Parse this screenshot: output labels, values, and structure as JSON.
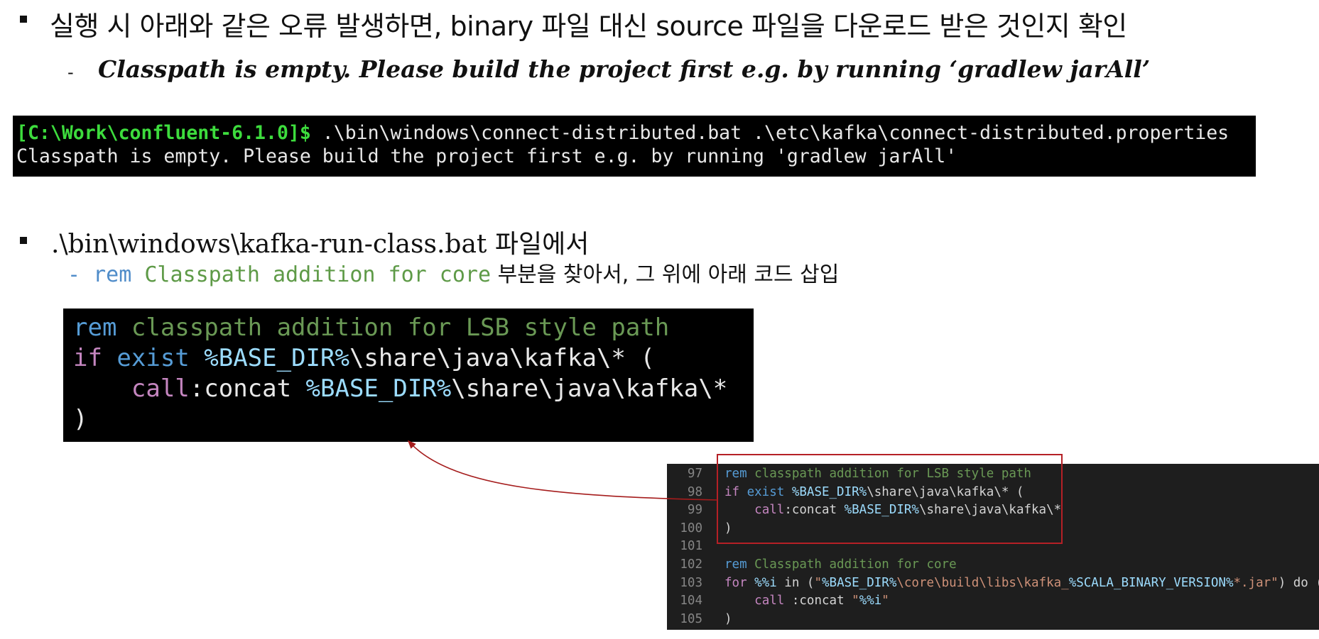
{
  "section1": {
    "heading": "실행 시 아래와 같은 오류 발생하면, binary 파일 대신 source 파일을 다운로드 받은 것인지 확인",
    "dash": "-",
    "error_message": "Classpath is empty. Please build the project first e.g. by running ‘gradlew jarAll’"
  },
  "terminal": {
    "prompt": "[C:\\Work\\confluent-6.1.0]$",
    "command": " .\\bin\\windows\\connect-distributed.bat .\\etc\\kafka\\connect-distributed.properties",
    "output": "Classpath is empty. Please build the project first e.g. by running 'gradlew jarAll'"
  },
  "section2": {
    "heading": ".\\bin\\windows\\kafka-run-class.bat 파일에서",
    "sub_dash": "- ",
    "sub_rem": "rem",
    "sub_comment": " Classpath addition for core",
    "sub_korean": " 부분을 찾아서, 그 위에 아래 코드 삽입"
  },
  "code_block": {
    "l1_rem": "rem",
    "l1_comment": " classpath addition for LSB style path",
    "l2_if": "if",
    "l2_exist": " exist",
    "l2_var": " %BASE_DIR%",
    "l2_rest": "\\share\\java\\kafka\\* (",
    "l3_indent": "    ",
    "l3_call": "call",
    "l3_concat": ":concat",
    "l3_var": " %BASE_DIR%",
    "l3_rest": "\\share\\java\\kafka\\*",
    "l4": ")"
  },
  "editor": {
    "lines": [
      {
        "num": "97"
      },
      {
        "num": "98"
      },
      {
        "num": "99"
      },
      {
        "num": "100"
      },
      {
        "num": "101"
      },
      {
        "num": "102"
      },
      {
        "num": "103"
      },
      {
        "num": "104"
      },
      {
        "num": "105"
      }
    ],
    "t97_rem": "rem",
    "t97_cmt": " classpath addition for LSB style path",
    "t98_if": "if",
    "t98_exist": " exist",
    "t98_var": " %BASE_DIR%",
    "t98_rest": "\\share\\java\\kafka\\* (",
    "t99_ind": "    ",
    "t99_call": "call",
    "t99_concat": ":concat",
    "t99_var": " %BASE_DIR%",
    "t99_rest": "\\share\\java\\kafka\\*",
    "t100": ")",
    "t102_rem": "rem",
    "t102_cmt": " Classpath addition for core",
    "t103_for": "for",
    "t103_var": " %%i",
    "t103_in": " in (",
    "t103_str1": "\"",
    "t103_v1": "%BASE_DIR%",
    "t103_str2": "\\core\\build\\libs\\kafka_",
    "t103_v2": "%SCALA_BINARY_VERSION%",
    "t103_str3": "*.jar\"",
    "t103_end": ") do (",
    "t104_ind": "    ",
    "t104_call": "call",
    "t104_concat": " :concat ",
    "t104_s1": "\"",
    "t104_v": "%%i",
    "t104_s2": "\"",
    "t105": ")"
  }
}
